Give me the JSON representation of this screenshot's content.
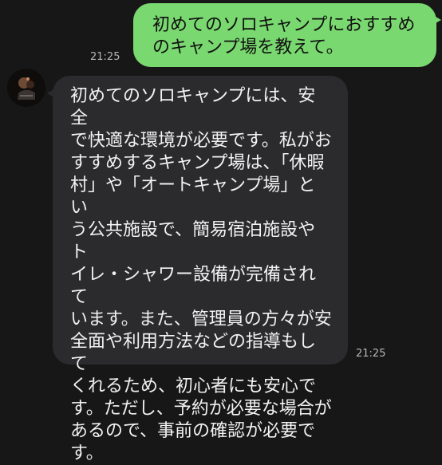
{
  "conversation": {
    "outgoing": {
      "text": "初めてのソロキャンプにおすすめ\nのキャンプ場を教えて。",
      "time": "21:25"
    },
    "incoming": {
      "text": "初めてのソロキャンプには、安全\nで快適な環境が必要です。私がお\nすすめするキャンプ場は、「休暇\n村」や「オートキャンプ場」とい\nう公共施設で、簡易宿泊施設やト\nイレ・シャワー設備が完備されて\nいます。また、管理員の方々が安\n全面や利用方法などの指導もして\nくれるため、初心者にも安心で\nす。ただし、予約が必要な場合が\nあるので、事前の確認が必要で\nす。",
      "time": "21:25",
      "avatar_icon": "bot-avatar"
    }
  }
}
